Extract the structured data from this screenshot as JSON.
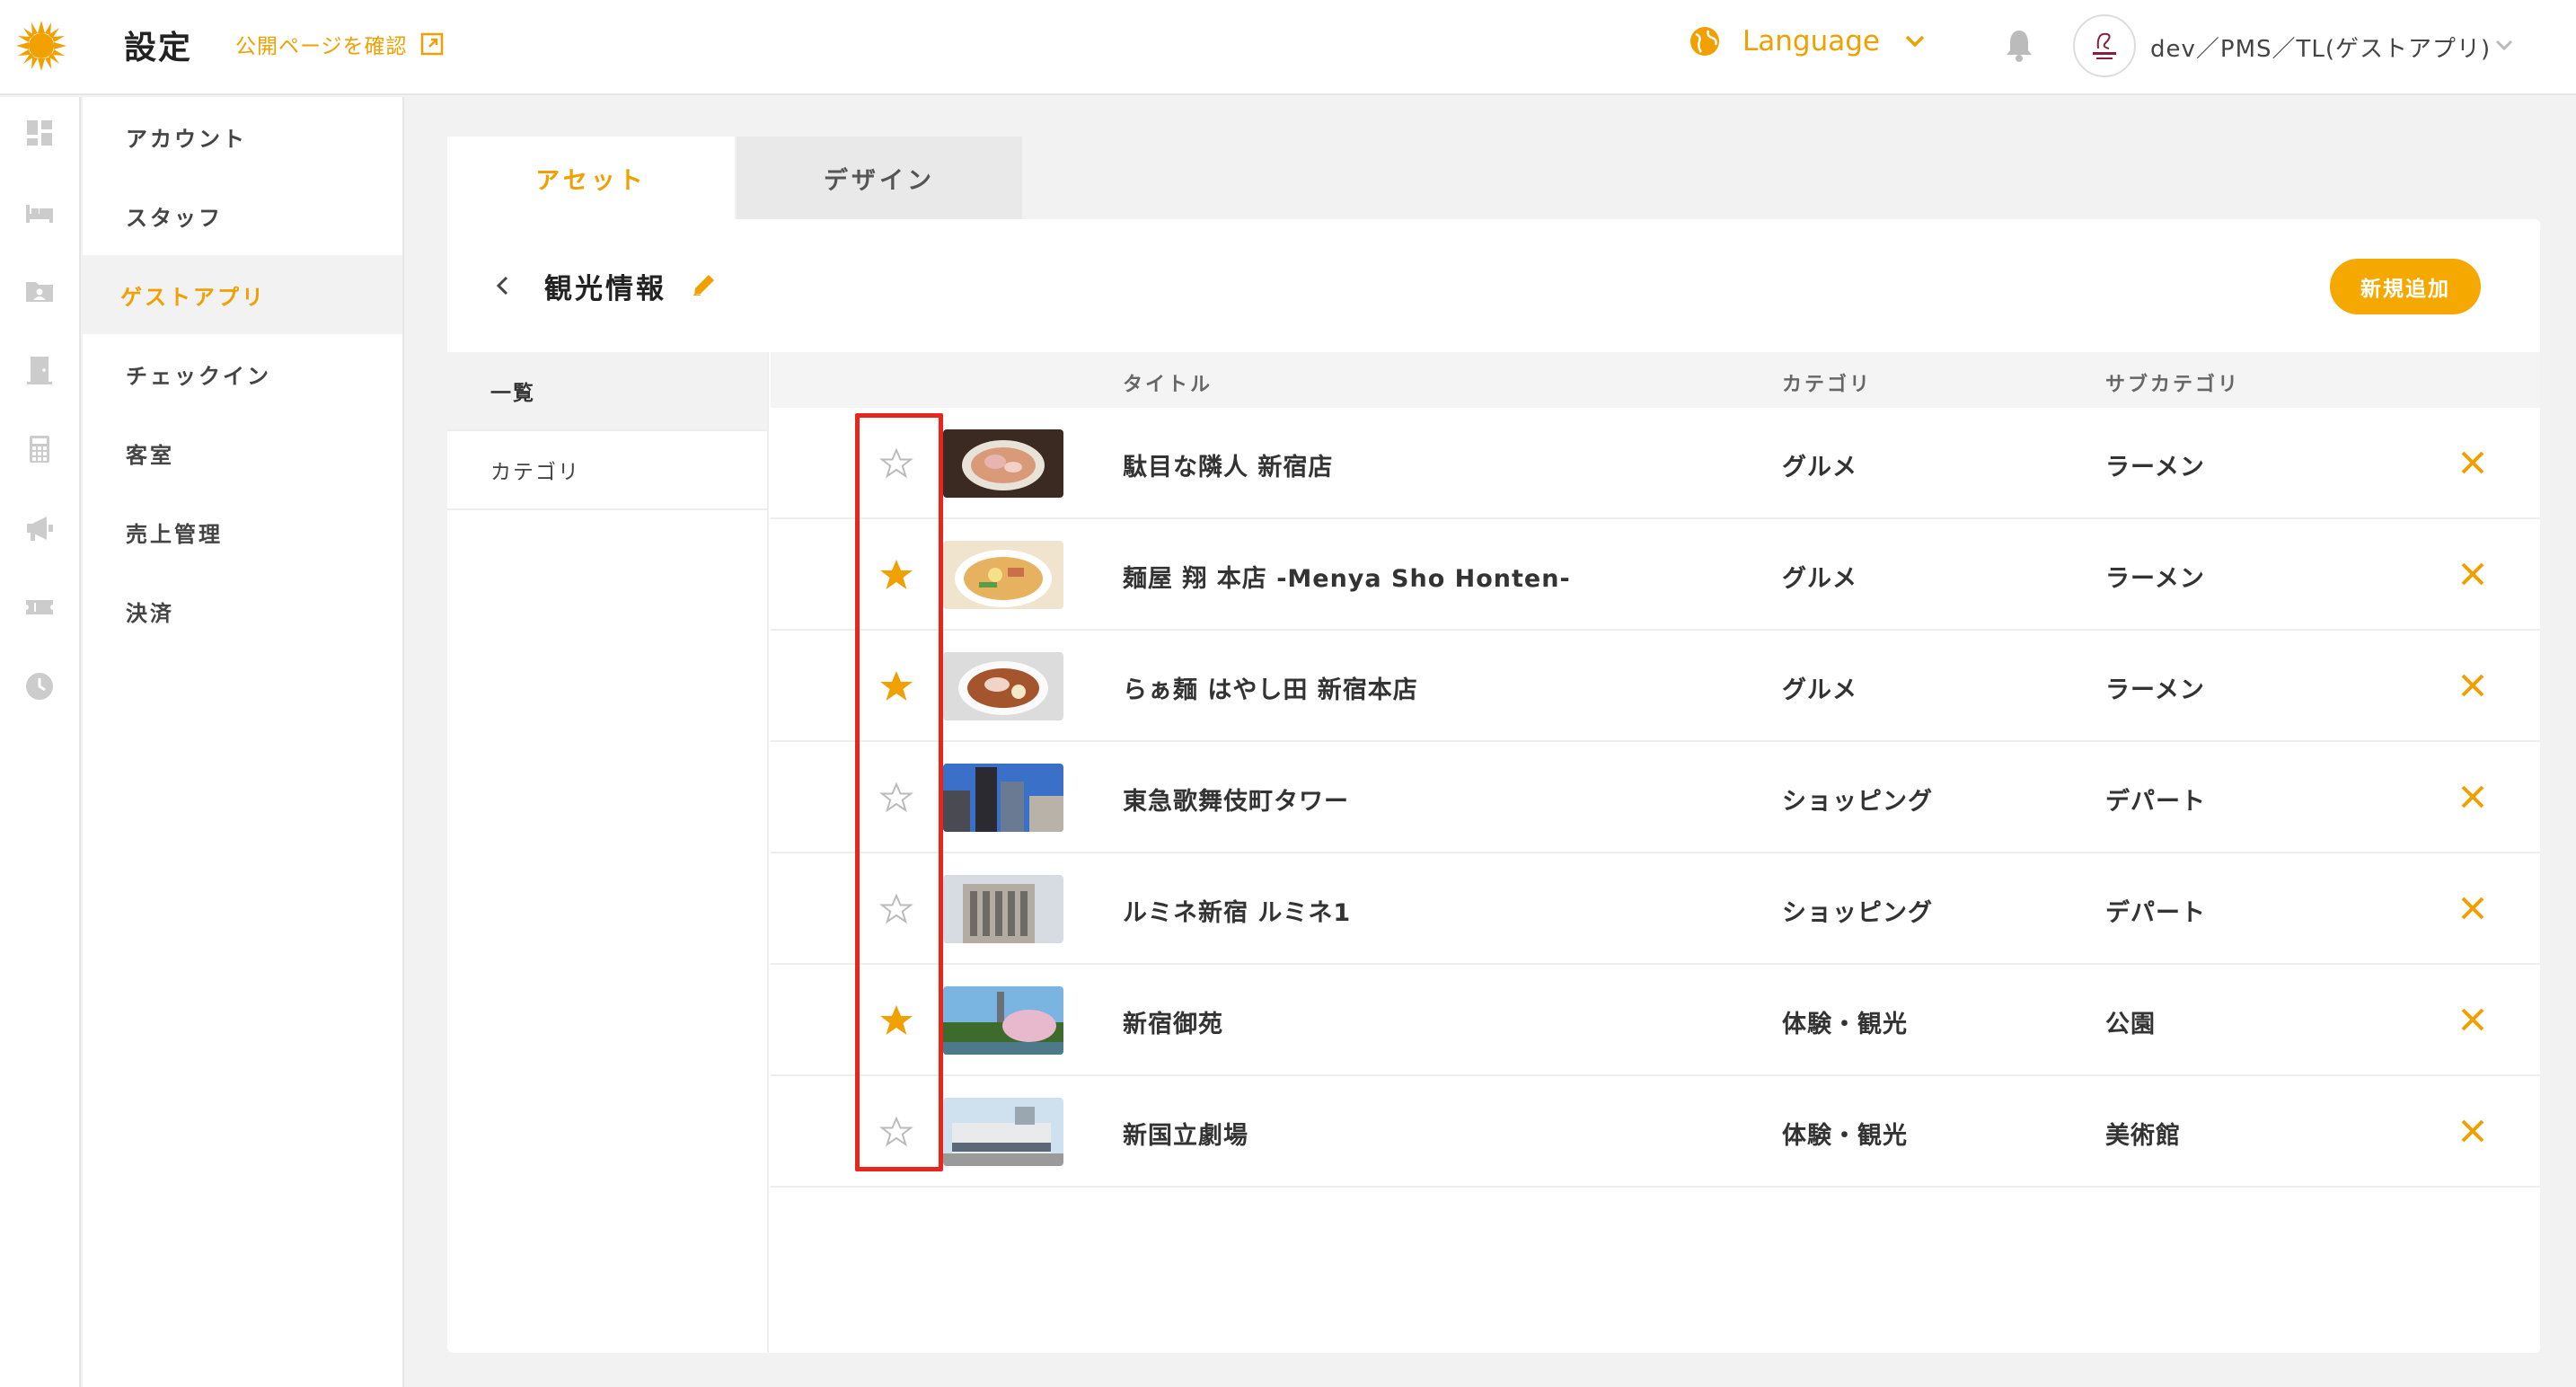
{
  "header": {
    "title": "設定",
    "public_link": "公開ページを確認",
    "language": "Language",
    "user_name": "dev／PMS／TL(ゲストアプリ)"
  },
  "colors": {
    "accent": "#f0a000",
    "highlight": "#e8261c"
  },
  "rail_icons": [
    "dashboard-icon",
    "bed-icon",
    "guest-folder-icon",
    "door-icon",
    "calculator-icon",
    "megaphone-icon",
    "ticket-icon",
    "clock-icon"
  ],
  "menu": {
    "items": [
      {
        "label": "アカウント"
      },
      {
        "label": "スタッフ"
      },
      {
        "label": "ゲストアプリ"
      },
      {
        "label": "チェックイン"
      },
      {
        "label": "客室"
      },
      {
        "label": "売上管理"
      },
      {
        "label": "決済"
      }
    ]
  },
  "tabs": [
    {
      "label": "アセット"
    },
    {
      "label": "デザイン"
    }
  ],
  "section": {
    "title": "観光情報",
    "add_label": "新規追加"
  },
  "subnav": [
    {
      "label": "一覧"
    },
    {
      "label": "カテゴリ"
    }
  ],
  "table": {
    "headers": {
      "title": "タイトル",
      "category": "カテゴリ",
      "subcategory": "サブカテゴリ"
    },
    "rows": [
      {
        "starred": false,
        "title": "駄目な隣人 新宿店",
        "category": "グルメ",
        "subcategory": "ラーメン"
      },
      {
        "starred": true,
        "title": "麺屋 翔 本店 -Menya Sho Honten-",
        "category": "グルメ",
        "subcategory": "ラーメン"
      },
      {
        "starred": true,
        "title": "らぁ麺 はやし田 新宿本店",
        "category": "グルメ",
        "subcategory": "ラーメン"
      },
      {
        "starred": false,
        "title": "東急歌舞伎町タワー",
        "category": "ショッピング",
        "subcategory": "デパート"
      },
      {
        "starred": false,
        "title": "ルミネ新宿 ルミネ1",
        "category": "ショッピング",
        "subcategory": "デパート"
      },
      {
        "starred": true,
        "title": "新宿御苑",
        "category": "体験・観光",
        "subcategory": "公園"
      },
      {
        "starred": false,
        "title": "新国立劇場",
        "category": "体験・観光",
        "subcategory": "美術館"
      }
    ]
  }
}
